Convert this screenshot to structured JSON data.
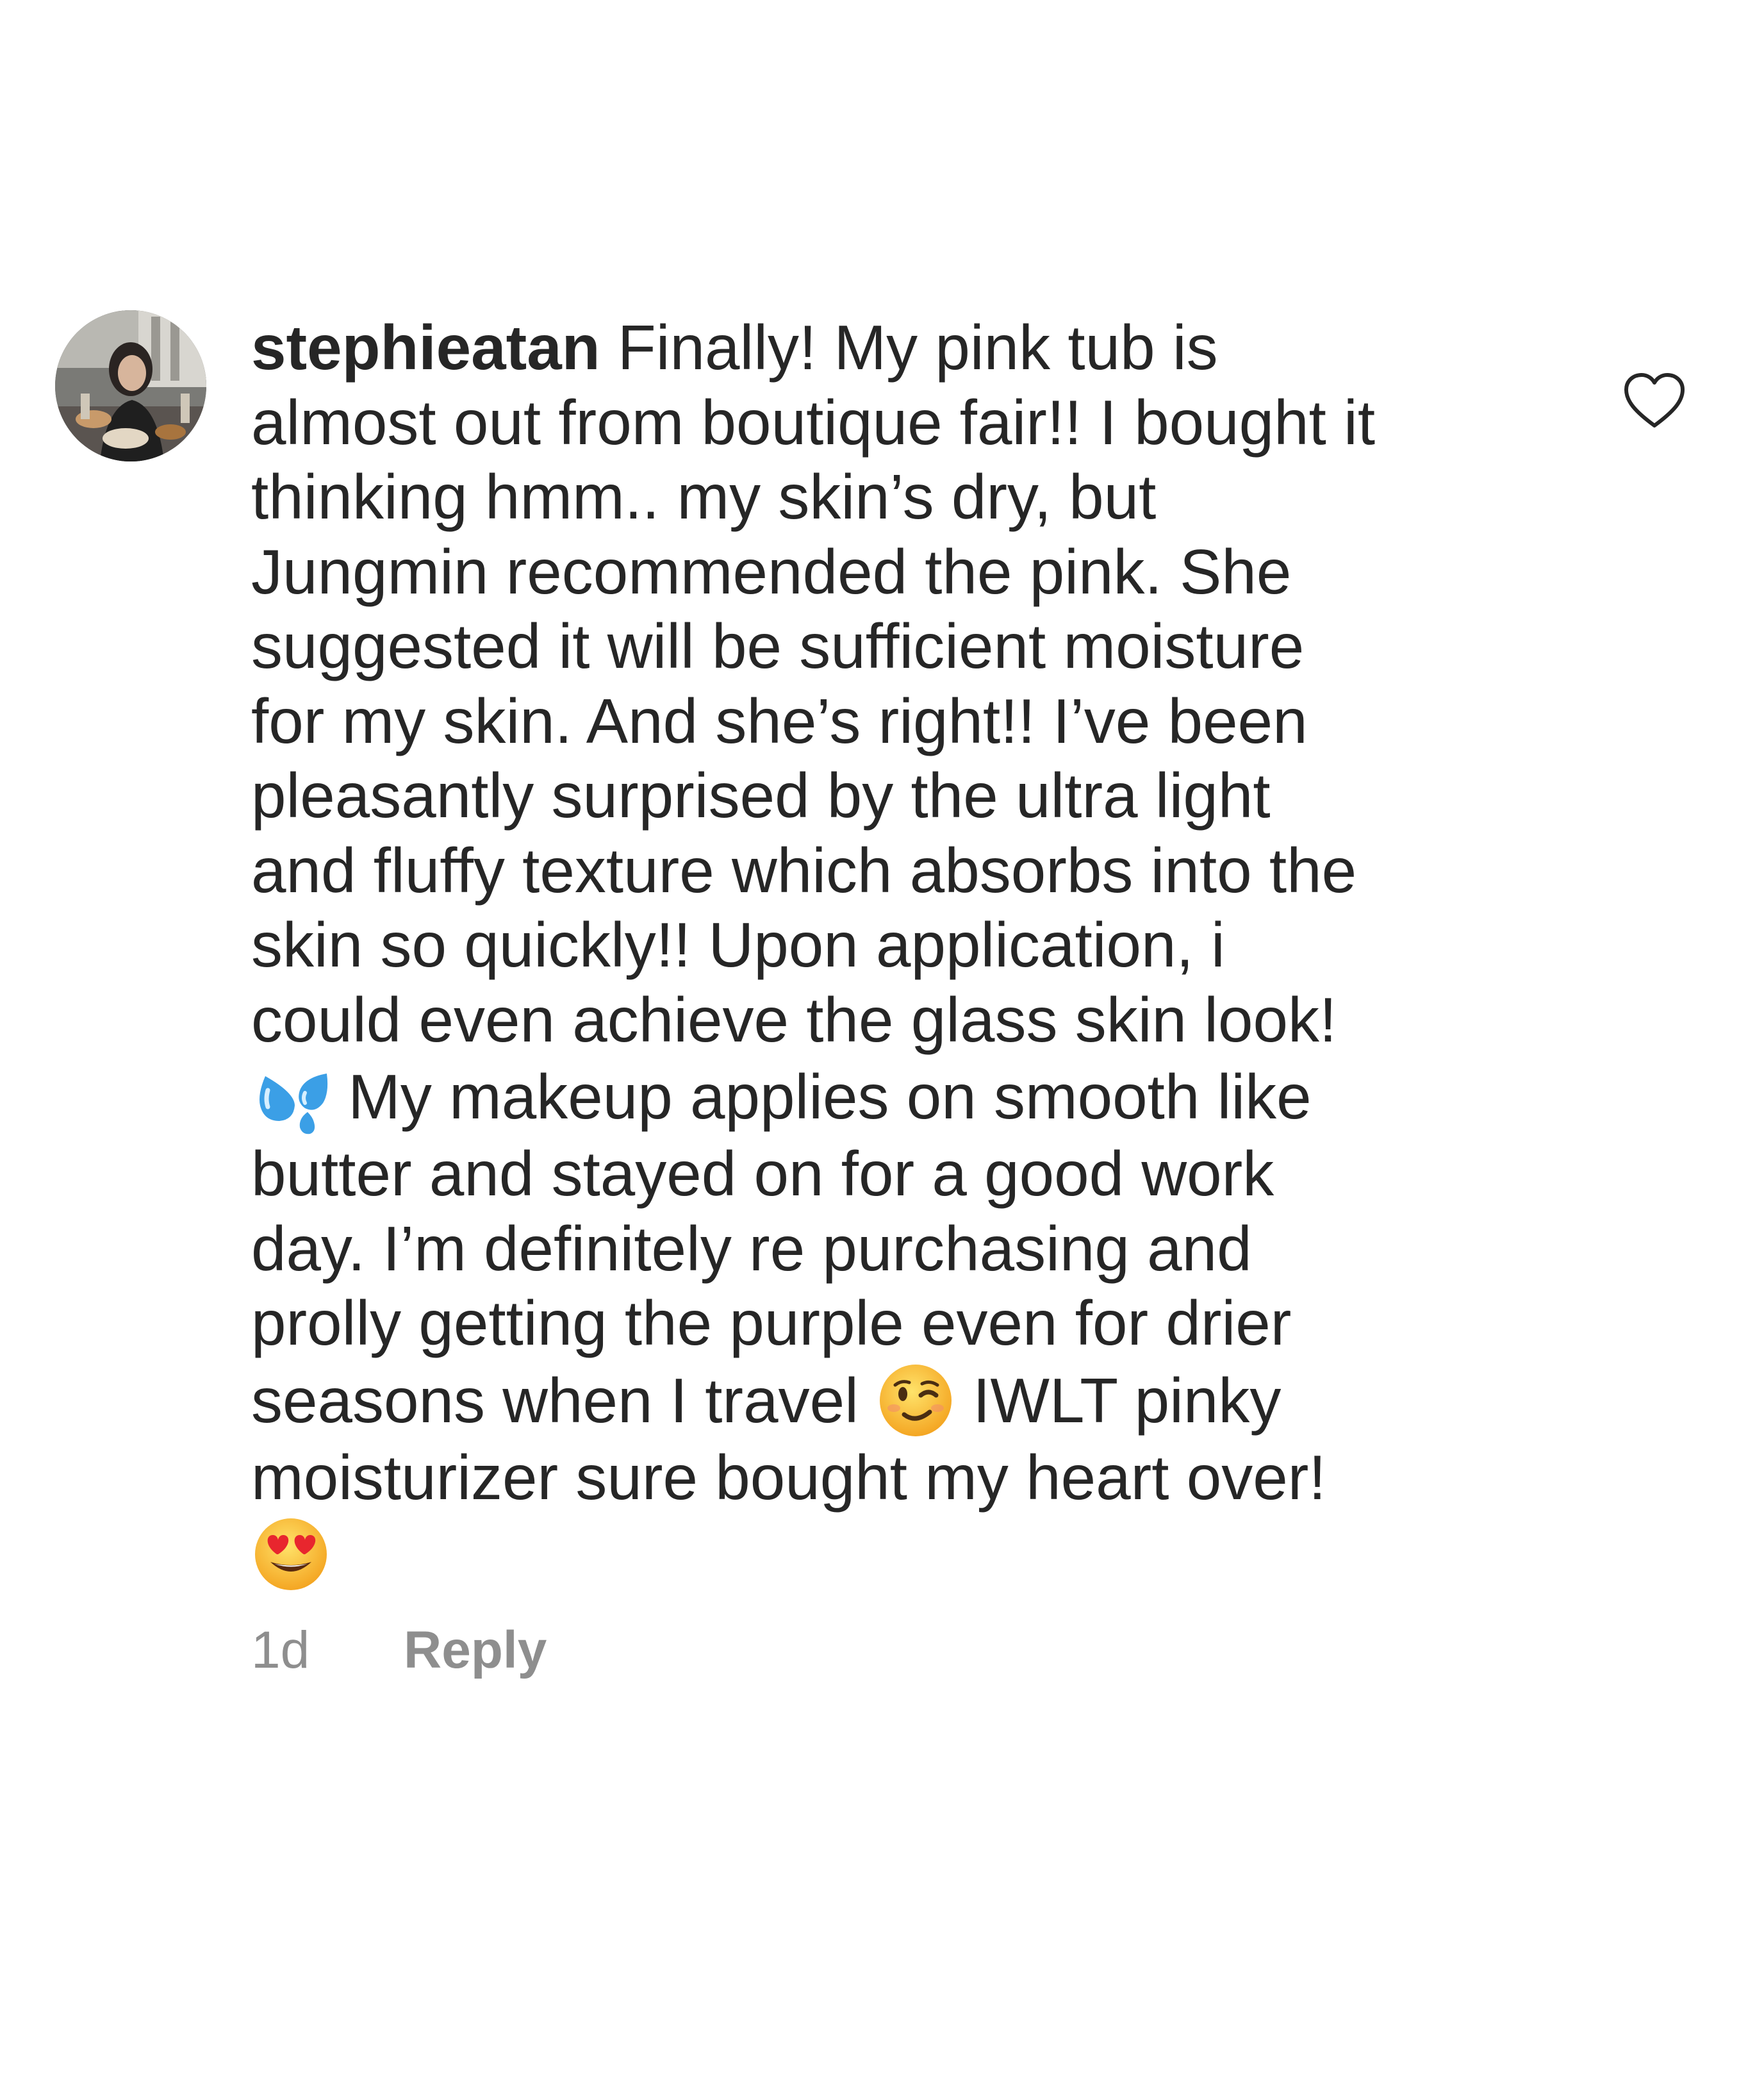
{
  "comment": {
    "username": "stephieatan",
    "avatar_icon": "profile-photo",
    "lines": [
      "Finally! My pink tub is",
      "almost out from boutique fair!! I bought it",
      "thinking hmm.. my skin’s dry, but",
      "Jungmin recommended the pink. She",
      "suggested it will be sufficient moisture",
      "for my skin. And she’s right!! I’ve been",
      "pleasantly surprised by the ultra light",
      "and fluffy texture which absorbs into the",
      "skin so quickly!! Upon application, i",
      "could even achieve the glass skin look!",
      " My makeup applies on smooth like",
      "butter and stayed on for a good work",
      "day. I’m definitely re purchasing and",
      "prolly getting the purple even for drier",
      "seasons when I travel ",
      " IWLT pinky",
      "moisturizer sure bought my heart over!"
    ],
    "emojis": {
      "sweat_droplets": "sweat-droplets-emoji",
      "winking_face": "winking-face-emoji",
      "heart_eyes": "heart-eyes-emoji"
    },
    "timestamp": "1d",
    "reply_label": "Reply",
    "like_icon": "heart-outline-icon",
    "colors": {
      "text": "#262626",
      "meta": "#8e8e8e",
      "background": "#ffffff"
    }
  }
}
